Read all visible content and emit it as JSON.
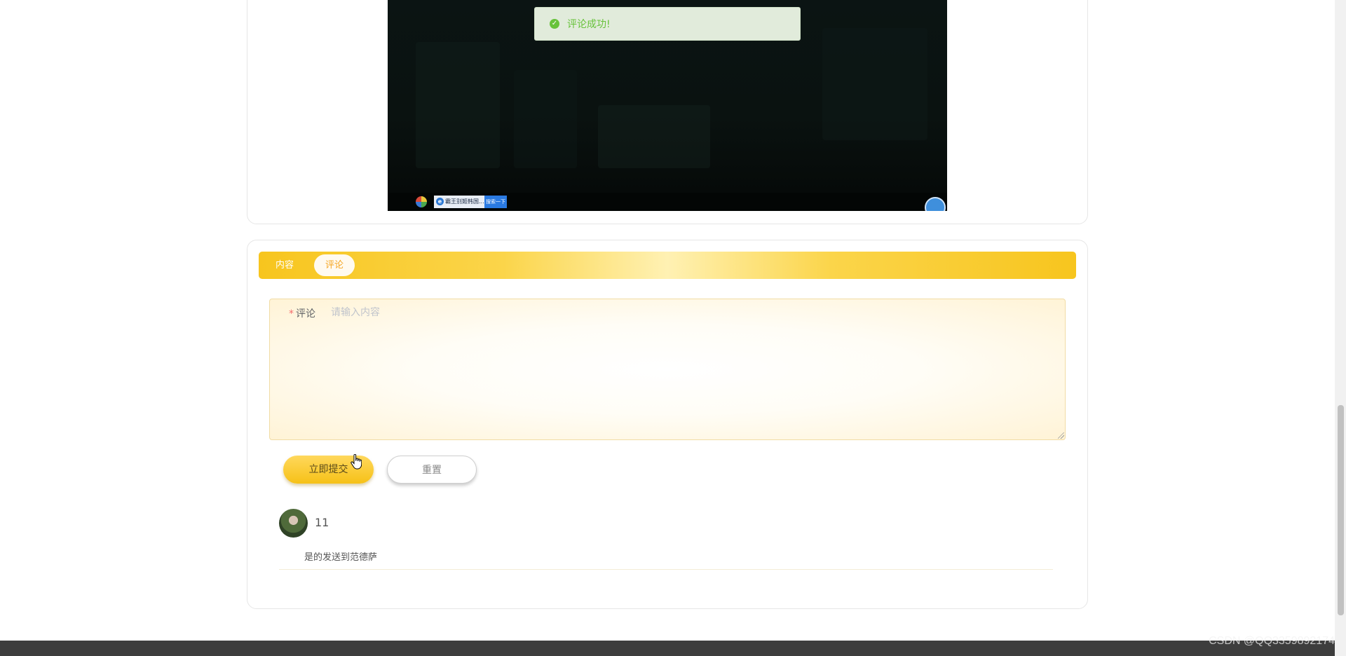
{
  "video": {
    "taskbar_tab": "霸王别姬韩国...",
    "taskbar_button": "搜索一下"
  },
  "toast": {
    "message": "评论成功!",
    "icon": "check-circle-icon"
  },
  "tabs": [
    {
      "label": "内容",
      "active": false
    },
    {
      "label": "评论",
      "active": true
    }
  ],
  "form": {
    "required_mark": "*",
    "comment_label": "评论",
    "comment_placeholder": "请输入内容",
    "comment_value": "",
    "submit_label": "立即提交",
    "reset_label": "重置"
  },
  "comments": [
    {
      "username": "11",
      "text": "是的发送到范德萨"
    }
  ],
  "watermark": "CSDN @QQ3359892174",
  "colors": {
    "accent": "#f7c51e",
    "success": "#67c23a",
    "required": "#f56c6c",
    "footer": "#3d3d3d"
  }
}
